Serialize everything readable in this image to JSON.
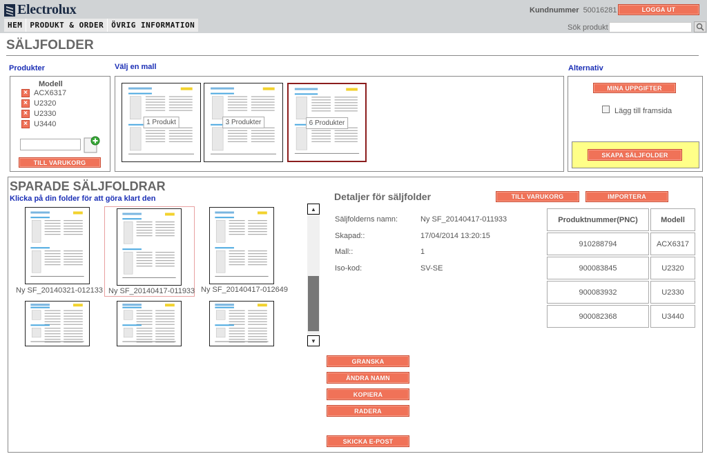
{
  "header": {
    "logo_text": "Electrolux",
    "customer_label": "Kundnummer",
    "customer_number": "50016281",
    "logout_label": "LOGGA UT",
    "search_label": "Sök produkt",
    "search_value": ""
  },
  "nav": [
    "HEM",
    "PRODUKT & ORDER",
    "ÖVRIG INFORMATION"
  ],
  "page_title": "SÄLJFOLDER",
  "products": {
    "section_label": "Produkter",
    "model_header": "Modell",
    "models": [
      "ACX6317",
      "U2320",
      "U2330",
      "U3440"
    ],
    "cart_button": "TILL VARUKORG"
  },
  "templates": {
    "section_label": "Välj en mall",
    "items": [
      "1 Produkt",
      "3 Produkter",
      "6 Produkter"
    ],
    "selected": "6 Produkter"
  },
  "alternatives": {
    "section_label": "Alternativ",
    "my_info_button": "MINA UPPGIFTER",
    "add_front_label": "Lägg till framsida",
    "add_front_checked": false,
    "create_button": "SKAPA SÄLJFOLDER"
  },
  "saved": {
    "title": "SPARADE SÄLJFOLDRAR",
    "subtitle": "Klicka på din folder för att göra klart den",
    "folders": [
      "Ny SF_20140321-012133",
      "Ny SF_20140417-011933",
      "Ny SF_20140417-012649",
      "",
      "",
      ""
    ],
    "selected": "Ny SF_20140417-011933"
  },
  "details": {
    "title": "Detaljer för säljfolder",
    "cart_button": "TILL VARUKORG",
    "import_button": "IMPORTERA",
    "fields": [
      {
        "label": "Säljfolderns namn:",
        "value": "Ny SF_20140417-011933"
      },
      {
        "label": "Skapad::",
        "value": "17/04/2014 13:20:15"
      },
      {
        "label": "Mall::",
        "value": "1"
      },
      {
        "label": "Iso-kod:",
        "value": "SV-SE"
      }
    ],
    "table": {
      "headers": [
        "Produktnummer(PNC)",
        "Modell"
      ],
      "rows": [
        [
          "910288794",
          "ACX6317"
        ],
        [
          "900083845",
          "U2320"
        ],
        [
          "900083932",
          "U2330"
        ],
        [
          "900082368",
          "U3440"
        ]
      ]
    }
  },
  "actions": {
    "review": "GRANSKA",
    "rename": "ÄNDRA NAMN",
    "copy": "KOPIERA",
    "delete": "RADERA",
    "send_email": "SKICKA E-POST"
  },
  "colors": {
    "accent_button": "#f07258",
    "link_blue": "#1a2eb5",
    "highlight_yellow": "#ffff88",
    "header_bg": "#d0d3d5"
  }
}
